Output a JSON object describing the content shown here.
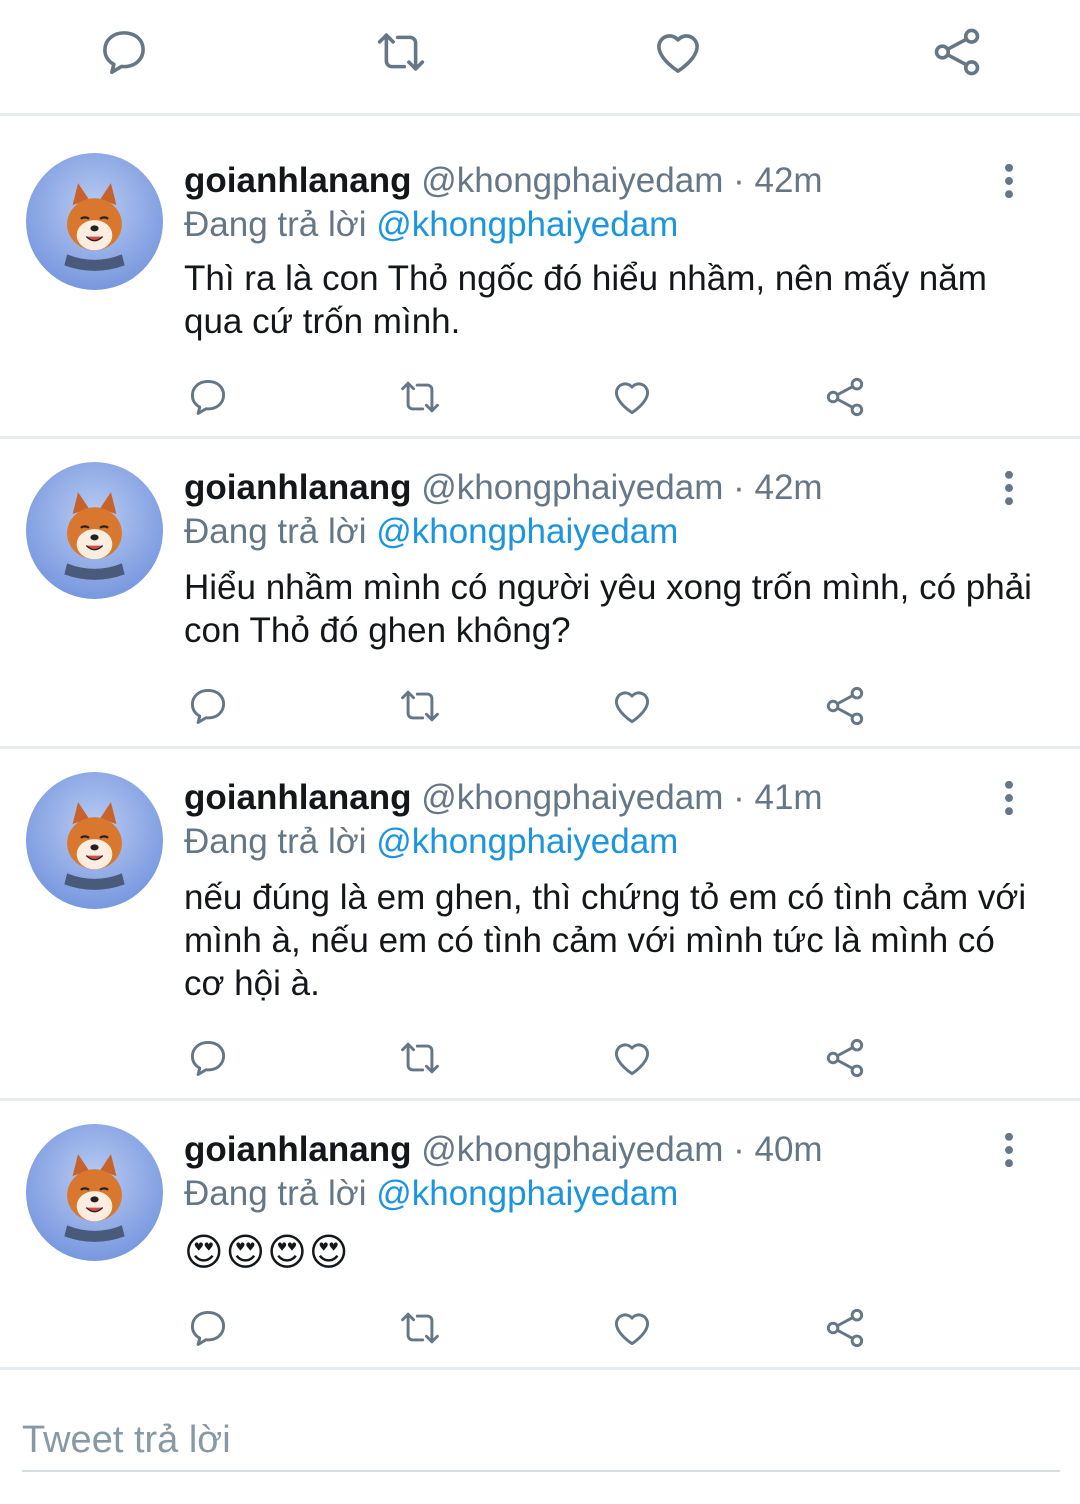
{
  "top_actions": {
    "icons": [
      "comment-icon",
      "retweet-icon",
      "like-icon",
      "share-icon"
    ]
  },
  "tweets": [
    {
      "username": "goianhlanang",
      "handle": "@khongphaiyedam",
      "time": "42m",
      "reply_prefix": "Đang trả lời",
      "reply_to": "@khongphaiyedam",
      "text": "Thì ra là con Thỏ ngốc đó hiểu nhầm, nên mấy năm qua cứ trốn mình."
    },
    {
      "username": "goianhlanang",
      "handle": "@khongphaiyedam",
      "time": "42m",
      "reply_prefix": "Đang trả lời",
      "reply_to": "@khongphaiyedam",
      "text": "Hiểu nhầm mình có người yêu xong trốn mình, có phải con Thỏ đó ghen không?"
    },
    {
      "username": "goianhlanang",
      "handle": "@khongphaiyedam",
      "time": "41m",
      "reply_prefix": "Đang trả lời",
      "reply_to": "@khongphaiyedam",
      "text": "nếu đúng là em ghen, thì chứng tỏ em có tình cảm với mình à, nếu em có tình cảm với mình tức là mình có cơ hội à."
    },
    {
      "username": "goianhlanang",
      "handle": "@khongphaiyedam",
      "time": "40m",
      "reply_prefix": "Đang trả lời",
      "reply_to": "@khongphaiyedam",
      "text": "😍😍😍😍"
    }
  ],
  "compose": {
    "placeholder": "Tweet trả lời"
  },
  "colors": {
    "link": "#1b95e0",
    "muted": "#657786",
    "divider": "#e6ecf0",
    "icon": "#657786"
  }
}
